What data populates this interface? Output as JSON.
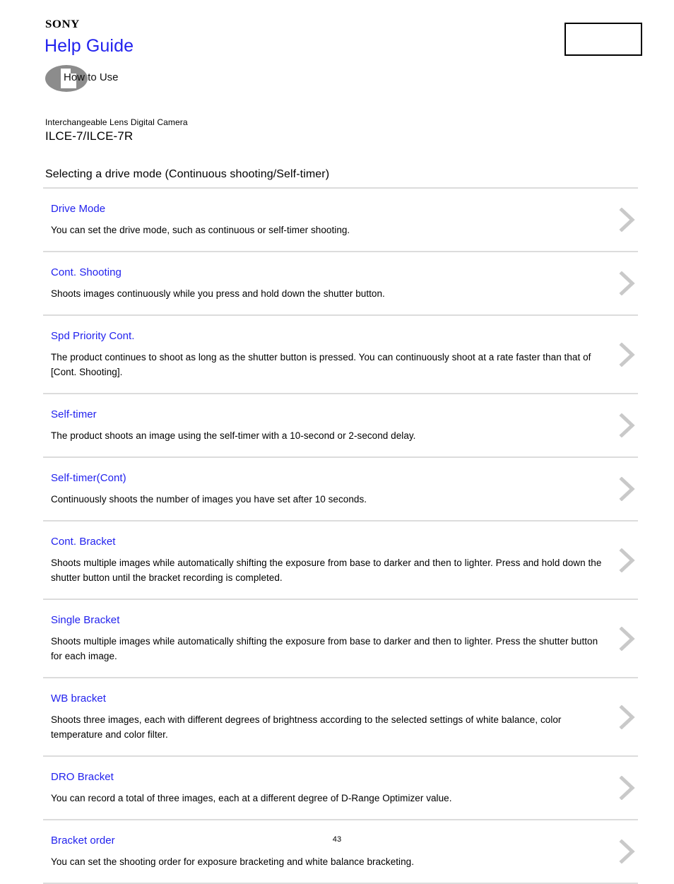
{
  "header": {
    "brand": "SONY",
    "site_title": "Help Guide",
    "how_to_use_label": "How to Use",
    "how_to_use_icon": "book-page-icon",
    "search_box_value": ""
  },
  "product": {
    "category": "Interchangeable Lens Digital Camera",
    "model": "ILCE-7/ILCE-7R"
  },
  "page": {
    "title": "Selecting a drive mode (Continuous shooting/Self-timer)",
    "number": "43"
  },
  "colors": {
    "link_blue": "#2222ee",
    "divider_gray": "#dcdcdc",
    "chevron_gray": "#c9c9c9",
    "icon_gray": "#8c8c8c"
  },
  "topics": [
    {
      "link": "Drive Mode",
      "desc": "You can set the drive mode, such as continuous or self-timer shooting.",
      "chevron": "chevron-right-icon"
    },
    {
      "link": "Cont. Shooting",
      "desc": "Shoots images continuously while you press and hold down the shutter button.",
      "chevron": "chevron-right-icon"
    },
    {
      "link": "Spd Priority Cont.",
      "desc": "The product continues to shoot as long as the shutter button is pressed. You can continuously shoot at a rate faster than that of [Cont. Shooting].",
      "chevron": "chevron-right-icon"
    },
    {
      "link": "Self-timer",
      "desc": "The product shoots an image using the self-timer with a 10-second or 2-second delay.",
      "chevron": "chevron-right-icon"
    },
    {
      "link": "Self-timer(Cont)",
      "desc": "Continuously shoots the number of images you have set after 10 seconds.",
      "chevron": "chevron-right-icon"
    },
    {
      "link": "Cont. Bracket",
      "desc": "Shoots multiple images while automatically shifting the exposure from base to darker and then to lighter. Press and hold down the shutter button until the bracket recording is completed.",
      "chevron": "chevron-right-icon"
    },
    {
      "link": "Single Bracket",
      "desc": "Shoots multiple images while automatically shifting the exposure from base to darker and then to lighter. Press the shutter button for each image.",
      "chevron": "chevron-right-icon"
    },
    {
      "link": "WB bracket",
      "desc": "Shoots three images, each with different degrees of brightness according to the selected settings of white balance, color temperature and color filter.",
      "chevron": "chevron-right-icon"
    },
    {
      "link": "DRO Bracket",
      "desc": "You can record a total of three images, each at a different degree of D-Range Optimizer value.",
      "chevron": "chevron-right-icon"
    },
    {
      "link": "Bracket order",
      "desc": "You can set the shooting order for exposure bracketing and white balance bracketing.",
      "chevron": "chevron-right-icon"
    }
  ]
}
